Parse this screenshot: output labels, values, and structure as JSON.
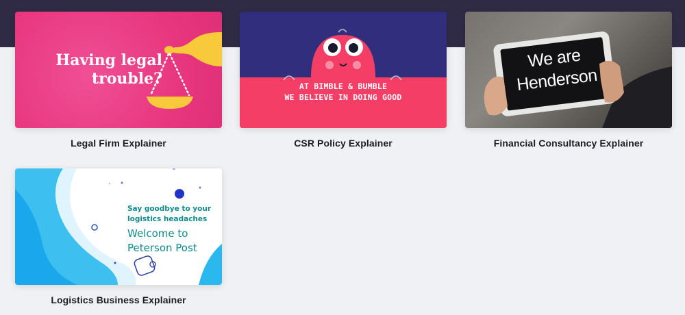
{
  "colors": {
    "header_band": "#302b45",
    "page_background": "#f0f1f4",
    "legal_pink": "#e8377f",
    "csr_navy": "#312e7e",
    "csr_red": "#f53e66",
    "logistics_teal": "#108a8c"
  },
  "templates": [
    {
      "caption": "Legal Firm Explainer",
      "thumbnail_lines": [
        "Having legal",
        "trouble?"
      ],
      "icon": "scales-icon"
    },
    {
      "caption": "CSR Policy Explainer",
      "thumbnail_lines": [
        "AT BIMBLE & BUMBLE",
        "WE BELIEVE IN DOING GOOD"
      ],
      "icon": "monster-character-icon"
    },
    {
      "caption": "Financial Consultancy Explainer",
      "thumbnail_lines": [
        "We are",
        "Henderson"
      ],
      "icon": "tablet-in-hands-icon"
    },
    {
      "caption": "Logistics Business Explainer",
      "thumbnail_lines": [
        "Say goodbye to your logistics headaches",
        "Welcome to",
        "Peterson Post"
      ],
      "icon": "package-outline-icon"
    }
  ]
}
